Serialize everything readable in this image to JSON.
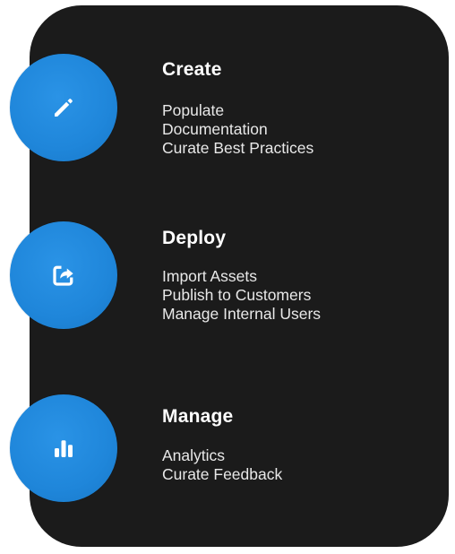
{
  "colors": {
    "panel_background": "#1b1b1b",
    "circle_fill": "#1f86da",
    "icon_fill": "#ffffff",
    "title_text": "#ffffff",
    "item_text": "#e8e8e8"
  },
  "sections": [
    {
      "title": "Create",
      "icon": "pencil-icon",
      "items": [
        "Populate",
        "Documentation",
        "Curate Best Practices"
      ]
    },
    {
      "title": "Deploy",
      "icon": "share-export-icon",
      "items": [
        "Import Assets",
        "Publish to Customers",
        "Manage Internal Users"
      ]
    },
    {
      "title": "Manage",
      "icon": "bar-chart-icon",
      "items": [
        "Analytics",
        "Curate Feedback"
      ]
    }
  ]
}
